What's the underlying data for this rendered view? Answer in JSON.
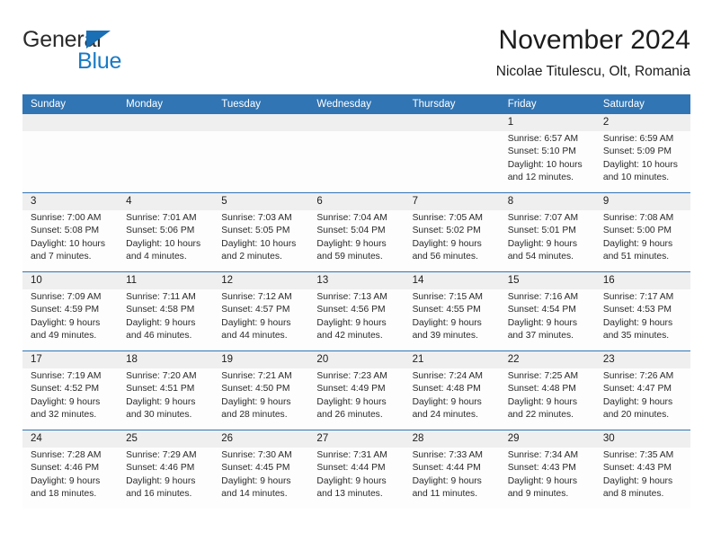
{
  "logo": {
    "word_one": "General",
    "word_two": "Blue",
    "triangle_color": "#1a6fb5",
    "blue_color": "#1a7ac4"
  },
  "header": {
    "title": "November 2024",
    "subtitle": "Nicolae Titulescu, Olt, Romania"
  },
  "theme": {
    "header_blue": "#3175b4",
    "date_strip_gray": "#efefef",
    "body_white": "#fdfdfd",
    "text_dark": "#1c1c1c"
  },
  "weekdays": [
    "Sunday",
    "Monday",
    "Tuesday",
    "Wednesday",
    "Thursday",
    "Friday",
    "Saturday"
  ],
  "weeks": [
    [
      {
        "day": "",
        "lines": []
      },
      {
        "day": "",
        "lines": []
      },
      {
        "day": "",
        "lines": []
      },
      {
        "day": "",
        "lines": []
      },
      {
        "day": "",
        "lines": []
      },
      {
        "day": "1",
        "lines": [
          "Sunrise: 6:57 AM",
          "Sunset: 5:10 PM",
          "Daylight: 10 hours",
          "and 12 minutes."
        ]
      },
      {
        "day": "2",
        "lines": [
          "Sunrise: 6:59 AM",
          "Sunset: 5:09 PM",
          "Daylight: 10 hours",
          "and 10 minutes."
        ]
      }
    ],
    [
      {
        "day": "3",
        "lines": [
          "Sunrise: 7:00 AM",
          "Sunset: 5:08 PM",
          "Daylight: 10 hours",
          "and 7 minutes."
        ]
      },
      {
        "day": "4",
        "lines": [
          "Sunrise: 7:01 AM",
          "Sunset: 5:06 PM",
          "Daylight: 10 hours",
          "and 4 minutes."
        ]
      },
      {
        "day": "5",
        "lines": [
          "Sunrise: 7:03 AM",
          "Sunset: 5:05 PM",
          "Daylight: 10 hours",
          "and 2 minutes."
        ]
      },
      {
        "day": "6",
        "lines": [
          "Sunrise: 7:04 AM",
          "Sunset: 5:04 PM",
          "Daylight: 9 hours",
          "and 59 minutes."
        ]
      },
      {
        "day": "7",
        "lines": [
          "Sunrise: 7:05 AM",
          "Sunset: 5:02 PM",
          "Daylight: 9 hours",
          "and 56 minutes."
        ]
      },
      {
        "day": "8",
        "lines": [
          "Sunrise: 7:07 AM",
          "Sunset: 5:01 PM",
          "Daylight: 9 hours",
          "and 54 minutes."
        ]
      },
      {
        "day": "9",
        "lines": [
          "Sunrise: 7:08 AM",
          "Sunset: 5:00 PM",
          "Daylight: 9 hours",
          "and 51 minutes."
        ]
      }
    ],
    [
      {
        "day": "10",
        "lines": [
          "Sunrise: 7:09 AM",
          "Sunset: 4:59 PM",
          "Daylight: 9 hours",
          "and 49 minutes."
        ]
      },
      {
        "day": "11",
        "lines": [
          "Sunrise: 7:11 AM",
          "Sunset: 4:58 PM",
          "Daylight: 9 hours",
          "and 46 minutes."
        ]
      },
      {
        "day": "12",
        "lines": [
          "Sunrise: 7:12 AM",
          "Sunset: 4:57 PM",
          "Daylight: 9 hours",
          "and 44 minutes."
        ]
      },
      {
        "day": "13",
        "lines": [
          "Sunrise: 7:13 AM",
          "Sunset: 4:56 PM",
          "Daylight: 9 hours",
          "and 42 minutes."
        ]
      },
      {
        "day": "14",
        "lines": [
          "Sunrise: 7:15 AM",
          "Sunset: 4:55 PM",
          "Daylight: 9 hours",
          "and 39 minutes."
        ]
      },
      {
        "day": "15",
        "lines": [
          "Sunrise: 7:16 AM",
          "Sunset: 4:54 PM",
          "Daylight: 9 hours",
          "and 37 minutes."
        ]
      },
      {
        "day": "16",
        "lines": [
          "Sunrise: 7:17 AM",
          "Sunset: 4:53 PM",
          "Daylight: 9 hours",
          "and 35 minutes."
        ]
      }
    ],
    [
      {
        "day": "17",
        "lines": [
          "Sunrise: 7:19 AM",
          "Sunset: 4:52 PM",
          "Daylight: 9 hours",
          "and 32 minutes."
        ]
      },
      {
        "day": "18",
        "lines": [
          "Sunrise: 7:20 AM",
          "Sunset: 4:51 PM",
          "Daylight: 9 hours",
          "and 30 minutes."
        ]
      },
      {
        "day": "19",
        "lines": [
          "Sunrise: 7:21 AM",
          "Sunset: 4:50 PM",
          "Daylight: 9 hours",
          "and 28 minutes."
        ]
      },
      {
        "day": "20",
        "lines": [
          "Sunrise: 7:23 AM",
          "Sunset: 4:49 PM",
          "Daylight: 9 hours",
          "and 26 minutes."
        ]
      },
      {
        "day": "21",
        "lines": [
          "Sunrise: 7:24 AM",
          "Sunset: 4:48 PM",
          "Daylight: 9 hours",
          "and 24 minutes."
        ]
      },
      {
        "day": "22",
        "lines": [
          "Sunrise: 7:25 AM",
          "Sunset: 4:48 PM",
          "Daylight: 9 hours",
          "and 22 minutes."
        ]
      },
      {
        "day": "23",
        "lines": [
          "Sunrise: 7:26 AM",
          "Sunset: 4:47 PM",
          "Daylight: 9 hours",
          "and 20 minutes."
        ]
      }
    ],
    [
      {
        "day": "24",
        "lines": [
          "Sunrise: 7:28 AM",
          "Sunset: 4:46 PM",
          "Daylight: 9 hours",
          "and 18 minutes."
        ]
      },
      {
        "day": "25",
        "lines": [
          "Sunrise: 7:29 AM",
          "Sunset: 4:46 PM",
          "Daylight: 9 hours",
          "and 16 minutes."
        ]
      },
      {
        "day": "26",
        "lines": [
          "Sunrise: 7:30 AM",
          "Sunset: 4:45 PM",
          "Daylight: 9 hours",
          "and 14 minutes."
        ]
      },
      {
        "day": "27",
        "lines": [
          "Sunrise: 7:31 AM",
          "Sunset: 4:44 PM",
          "Daylight: 9 hours",
          "and 13 minutes."
        ]
      },
      {
        "day": "28",
        "lines": [
          "Sunrise: 7:33 AM",
          "Sunset: 4:44 PM",
          "Daylight: 9 hours",
          "and 11 minutes."
        ]
      },
      {
        "day": "29",
        "lines": [
          "Sunrise: 7:34 AM",
          "Sunset: 4:43 PM",
          "Daylight: 9 hours",
          "and 9 minutes."
        ]
      },
      {
        "day": "30",
        "lines": [
          "Sunrise: 7:35 AM",
          "Sunset: 4:43 PM",
          "Daylight: 9 hours",
          "and 8 minutes."
        ]
      }
    ]
  ]
}
